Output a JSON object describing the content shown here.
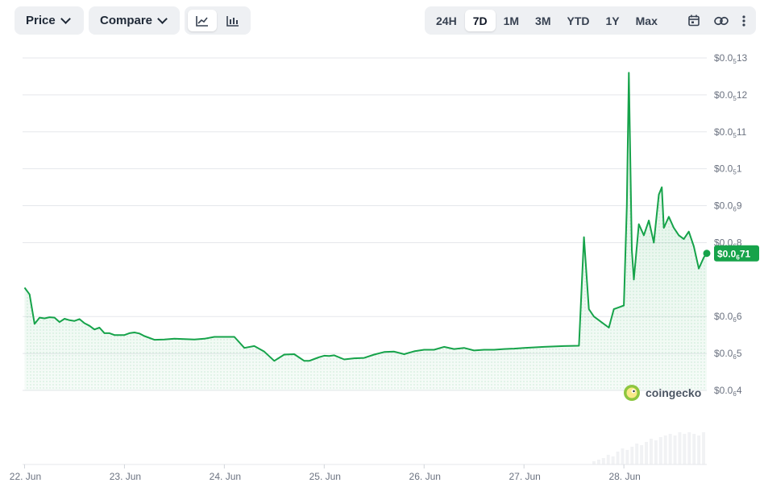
{
  "toolbar": {
    "price_label": "Price",
    "compare_label": "Compare",
    "ranges": [
      "24H",
      "7D",
      "1M",
      "3M",
      "YTD",
      "1Y",
      "Max"
    ],
    "active_range": "7D"
  },
  "icons": {
    "line_chart": "line-chart-icon",
    "candle_chart": "candlestick-chart-icon",
    "calendar": "calendar-icon",
    "link": "link-icon",
    "more": "more-vertical-icon"
  },
  "colors": {
    "line": "#16a34a",
    "fill": "#16a34a",
    "grid": "#e5e7eb",
    "badge_bg": "#16a34a",
    "badge_text": "#ffffff",
    "axis_text": "#6b7280"
  },
  "watermark": {
    "text": "coingecko"
  },
  "chart_data": {
    "type": "area",
    "xlabel": "",
    "ylabel": "",
    "x_tick_labels": [
      "22. Jun",
      "23. Jun",
      "24. Jun",
      "25. Jun",
      "26. Jun",
      "27. Jun",
      "28. Jun"
    ],
    "x_tick_days": [
      0,
      1,
      2,
      3,
      4,
      5,
      6
    ],
    "xlim_days": [
      -0.02,
      6.83
    ],
    "y_unit_note": "subscript notation: $0.0₅13 = 0.0000013",
    "y_ticks": [
      {
        "value": 1.3e-06,
        "prefix": "$0.0",
        "sub": "5",
        "digits": "13"
      },
      {
        "value": 1.2e-06,
        "prefix": "$0.0",
        "sub": "5",
        "digits": "12"
      },
      {
        "value": 1.1e-06,
        "prefix": "$0.0",
        "sub": "5",
        "digits": "11"
      },
      {
        "value": 1e-06,
        "prefix": "$0.0",
        "sub": "5",
        "digits": "1"
      },
      {
        "value": 9e-07,
        "prefix": "$0.0",
        "sub": "6",
        "digits": "9"
      },
      {
        "value": 8e-07,
        "prefix": "$0.0",
        "sub": "6",
        "digits": "8"
      },
      {
        "value": 6e-07,
        "prefix": "$0.0",
        "sub": "6",
        "digits": "6"
      },
      {
        "value": 5e-07,
        "prefix": "$0.0",
        "sub": "6",
        "digits": "5"
      },
      {
        "value": 4e-07,
        "prefix": "$0.0",
        "sub": "6",
        "digits": "4"
      }
    ],
    "ylim": [
      4e-07,
      1.3e-06
    ],
    "grid": true,
    "current": {
      "value": 7.71e-07,
      "prefix": "$0.0",
      "sub": "6",
      "digits": "71"
    },
    "series": [
      {
        "x": [
          0,
          0.05,
          0.1,
          0.15,
          0.2,
          0.25,
          0.3,
          0.35,
          0.4,
          0.45,
          0.5,
          0.55,
          0.6,
          0.65,
          0.7,
          0.75,
          0.8,
          0.85,
          0.9,
          0.95,
          1.0,
          1.05,
          1.1,
          1.15,
          1.2,
          1.3,
          1.4,
          1.5,
          1.6,
          1.7,
          1.8,
          1.9,
          2.0,
          2.1,
          2.2,
          2.3,
          2.4,
          2.5,
          2.6,
          2.7,
          2.8,
          2.85,
          2.9,
          2.95,
          3.0,
          3.05,
          3.1,
          3.2,
          3.3,
          3.4,
          3.5,
          3.6,
          3.7,
          3.8,
          3.9,
          4.0,
          4.1,
          4.2,
          4.3,
          4.4,
          4.5,
          4.6,
          4.7,
          4.8,
          4.9,
          5.0,
          5.2,
          5.4,
          5.55,
          5.6,
          5.65,
          5.7,
          5.75,
          5.8,
          5.85,
          5.9,
          5.95,
          6.0,
          6.03,
          6.05,
          6.08,
          6.1,
          6.15,
          6.2,
          6.25,
          6.3,
          6.35,
          6.38,
          6.4,
          6.45,
          6.5,
          6.55,
          6.6,
          6.65,
          6.7,
          6.75,
          6.8,
          6.83
        ],
        "y": [
          6.78e-07,
          6.6e-07,
          5.8e-07,
          5.97e-07,
          5.95e-07,
          5.98e-07,
          5.97e-07,
          5.85e-07,
          5.94e-07,
          5.9e-07,
          5.88e-07,
          5.93e-07,
          5.82e-07,
          5.75e-07,
          5.65e-07,
          5.7e-07,
          5.55e-07,
          5.55e-07,
          5.5e-07,
          5.5e-07,
          5.5e-07,
          5.55e-07,
          5.57e-07,
          5.54e-07,
          5.47e-07,
          5.37e-07,
          5.38e-07,
          5.4e-07,
          5.39e-07,
          5.38e-07,
          5.4e-07,
          5.45e-07,
          5.45e-07,
          5.45e-07,
          5.15e-07,
          5.2e-07,
          5.05e-07,
          4.8e-07,
          4.97e-07,
          4.98e-07,
          4.8e-07,
          4.8e-07,
          4.85e-07,
          4.9e-07,
          4.94e-07,
          4.93e-07,
          4.95e-07,
          4.84e-07,
          4.87e-07,
          4.88e-07,
          4.97e-07,
          5.04e-07,
          5.05e-07,
          4.98e-07,
          5.06e-07,
          5.1e-07,
          5.1e-07,
          5.18e-07,
          5.12e-07,
          5.15e-07,
          5.08e-07,
          5.1e-07,
          5.1e-07,
          5.12e-07,
          5.13e-07,
          5.15e-07,
          5.18e-07,
          5.2e-07,
          5.21e-07,
          8.15e-07,
          6.2e-07,
          6e-07,
          5.9e-07,
          5.8e-07,
          5.7e-07,
          6.2e-07,
          6.25e-07,
          6.3e-07,
          9e-07,
          1.26e-06,
          7.8e-07,
          7e-07,
          8.5e-07,
          8.2e-07,
          8.6e-07,
          8e-07,
          9.3e-07,
          9.5e-07,
          8.4e-07,
          8.7e-07,
          8.4e-07,
          8.2e-07,
          8.1e-07,
          8.3e-07,
          7.9e-07,
          7.3e-07,
          7.6e-07,
          7.71e-07
        ]
      }
    ],
    "volume": [
      0.1,
      0.15,
      0.2,
      0.3,
      0.25,
      0.4,
      0.5,
      0.45,
      0.55,
      0.65,
      0.6,
      0.7,
      0.8,
      0.75,
      0.85,
      0.9,
      0.95,
      0.9,
      1.0,
      0.95,
      1.0,
      0.95,
      0.9,
      1.0
    ]
  }
}
